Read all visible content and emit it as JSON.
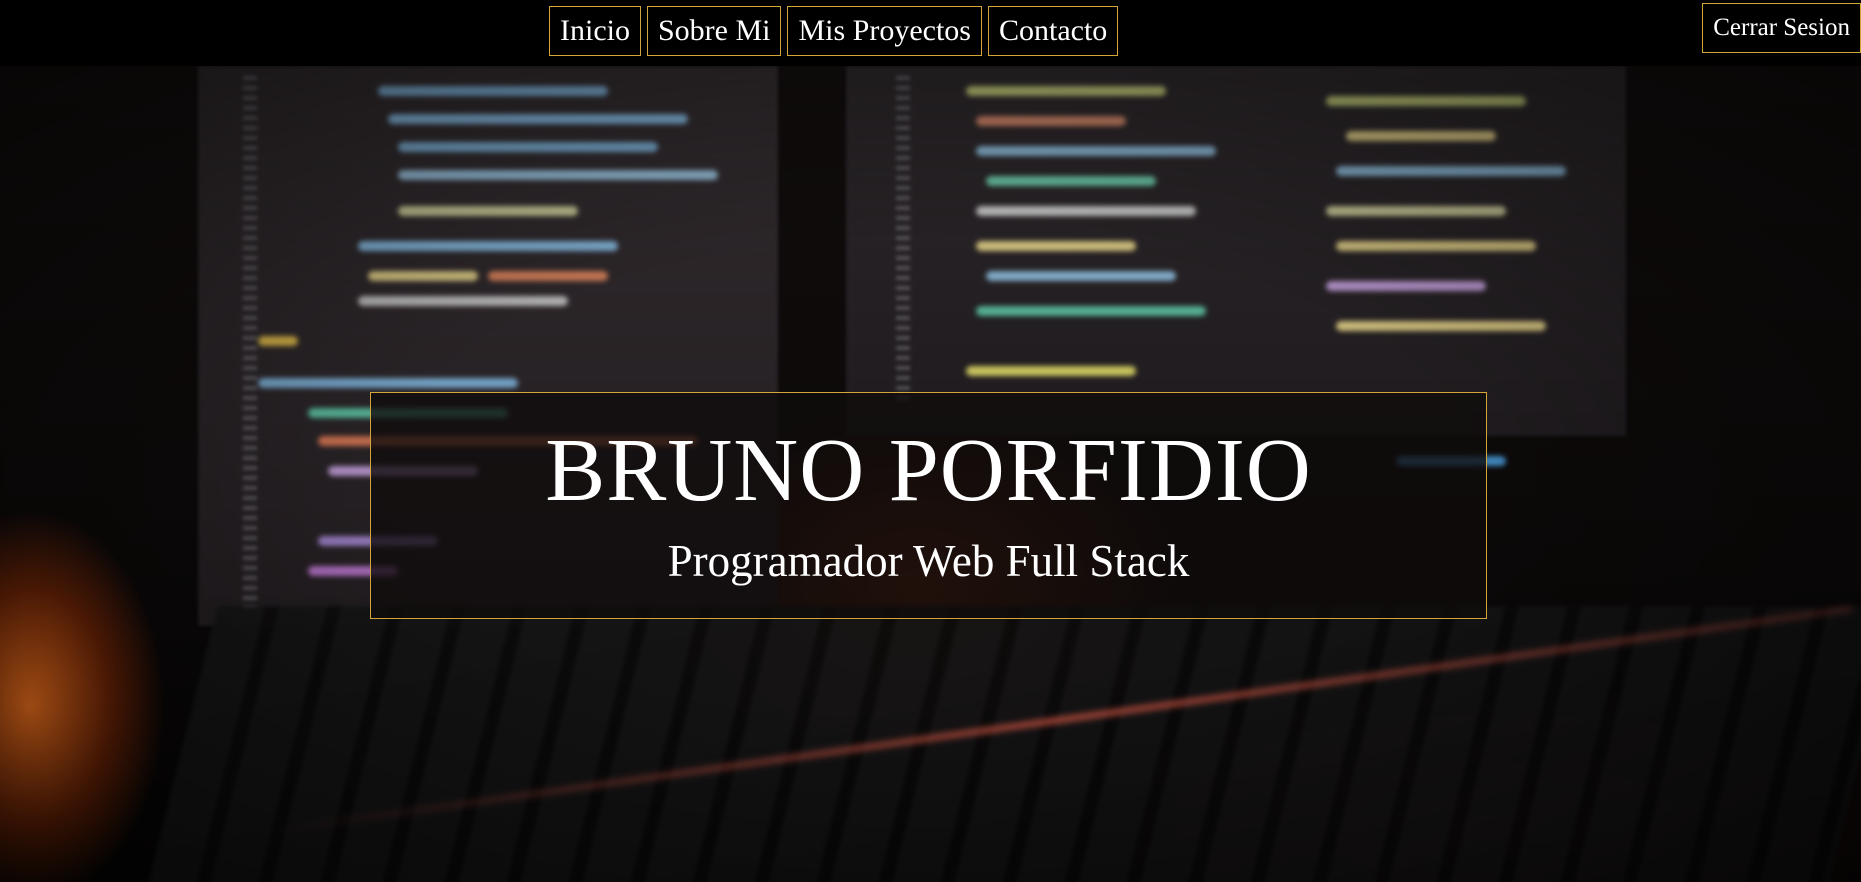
{
  "nav": {
    "items": [
      {
        "label": "Inicio"
      },
      {
        "label": "Sobre Mi"
      },
      {
        "label": "Mis Proyectos"
      },
      {
        "label": "Contacto"
      }
    ],
    "logout_label": "Cerrar Sesion"
  },
  "hero": {
    "name": "BRUNO PORFIDIO",
    "role": "Programador Web Full Stack"
  },
  "colors": {
    "accent_border": "#d4a63a",
    "text": "#ffffff",
    "background": "#000000"
  }
}
